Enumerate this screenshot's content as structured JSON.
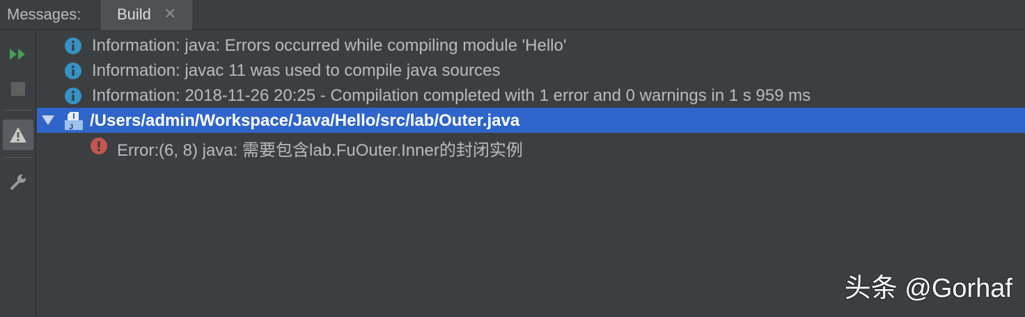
{
  "tabbar": {
    "title": "Messages:",
    "active_tab": "Build",
    "close_glyph": "✕"
  },
  "toolbar": {
    "items": [
      "rerun-icon",
      "stop-icon",
      "warning-filter-icon",
      "settings-wrench-icon"
    ]
  },
  "messages": [
    {
      "type": "info",
      "text": "Information: java: Errors occurred while compiling module 'Hello'"
    },
    {
      "type": "info",
      "text": "Information: javac 11 was used to compile java sources"
    },
    {
      "type": "info",
      "text": "Information: 2018-11-26 20:25 - Compilation completed with 1 error and 0 warnings in 1 s 959 ms"
    }
  ],
  "file": {
    "path": "/Users/admin/Workspace/Java/Hello/src/lab/Outer.java",
    "expanded": true
  },
  "error": {
    "text": "Error:(6, 8)  java: 需要包含lab.FuOuter.Inner的封闭实例"
  },
  "watermark": "头条 @Gorhaf",
  "colors": {
    "background": "#3c3f41",
    "selection": "#2f65ca",
    "info_icon": "#3592c4",
    "error_icon": "#c75450",
    "run_green": "#499c54"
  }
}
